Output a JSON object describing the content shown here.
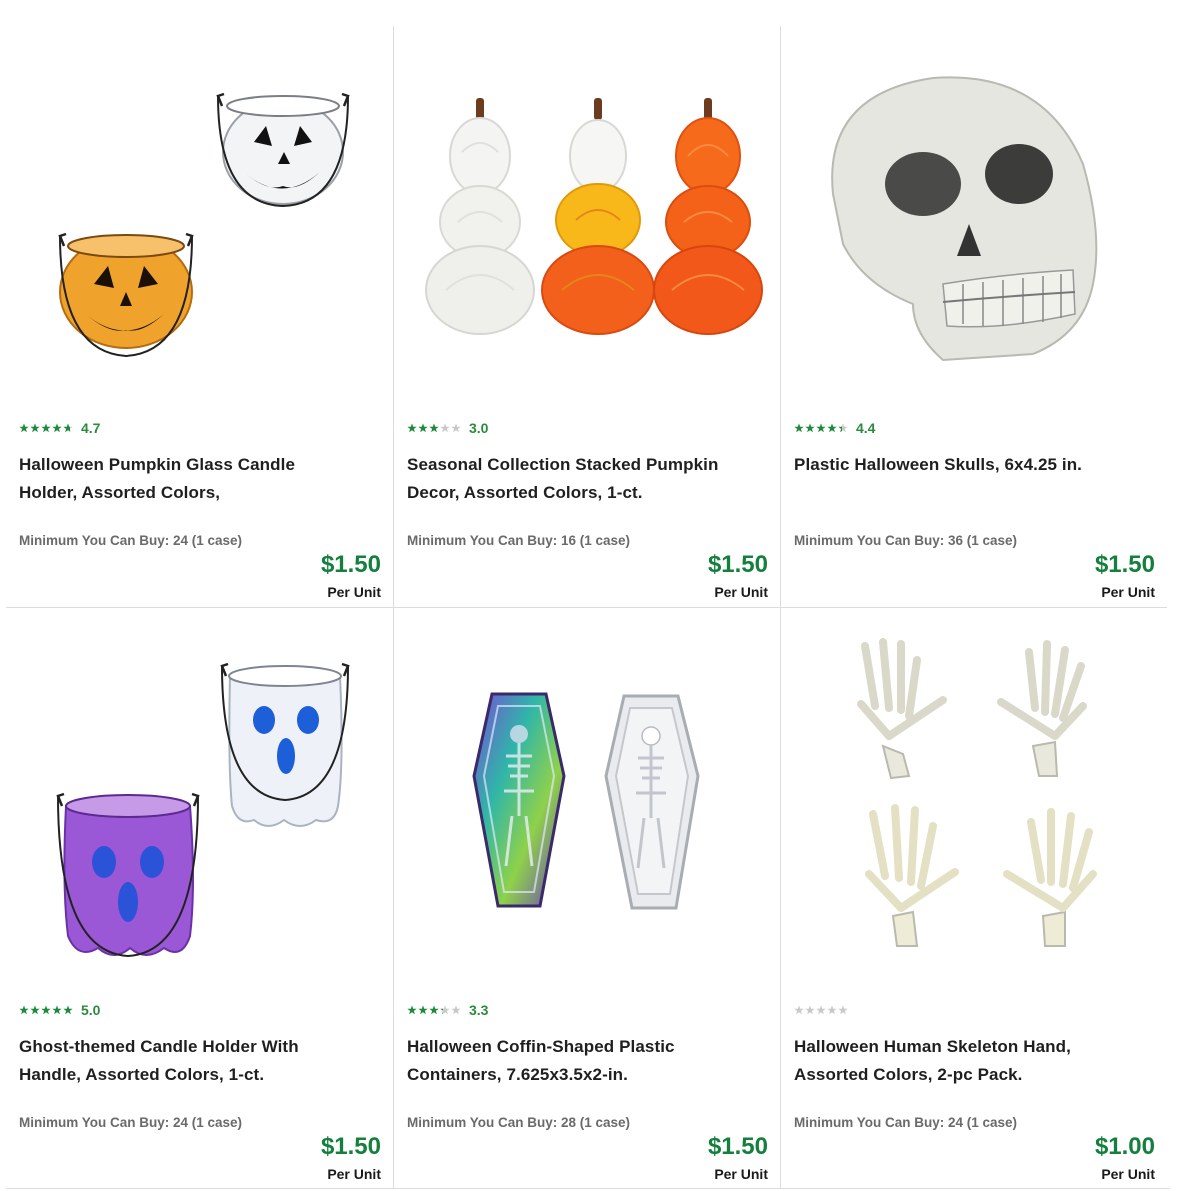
{
  "products": [
    {
      "name": "Halloween Pumpkin Glass Candle Holder, Assorted Colors,",
      "rating": "4.7",
      "stars": 4.7,
      "min_buy": "Minimum You Can Buy: 24 (1 case)",
      "price": "$1.50",
      "unit": "Per Unit"
    },
    {
      "name": "Seasonal Collection Stacked Pumpkin Decor, Assorted Colors, 1-ct.",
      "rating": "3.0",
      "stars": 3.0,
      "min_buy": "Minimum You Can Buy: 16 (1 case)",
      "price": "$1.50",
      "unit": "Per Unit"
    },
    {
      "name": "Plastic Halloween Skulls, 6x4.25 in.",
      "rating": "4.4",
      "stars": 4.4,
      "min_buy": "Minimum You Can Buy: 36 (1 case)",
      "price": "$1.50",
      "unit": "Per Unit"
    },
    {
      "name": "Ghost-themed Candle Holder With Handle, Assorted Colors, 1-ct.",
      "rating": "5.0",
      "stars": 5.0,
      "min_buy": "Minimum You Can Buy: 24 (1 case)",
      "price": "$1.50",
      "unit": "Per Unit"
    },
    {
      "name": "Halloween Coffin-Shaped Plastic Containers, 7.625x3.5x2-in.",
      "rating": "3.3",
      "stars": 3.3,
      "min_buy": "Minimum You Can Buy: 28 (1 case)",
      "price": "$1.50",
      "unit": "Per Unit"
    },
    {
      "name": "Halloween Human Skeleton Hand, Assorted Colors, 2-pc Pack.",
      "rating": "",
      "stars": 0,
      "min_buy": "Minimum You Can Buy: 24 (1 case)",
      "price": "$1.00",
      "unit": "Per Unit"
    }
  ],
  "colors": {
    "star_filled": "#1f8a3b",
    "star_empty": "#c9c9c9",
    "price": "#15803d",
    "divider": "#dcdcdc"
  },
  "icons": [
    "star-icon"
  ]
}
